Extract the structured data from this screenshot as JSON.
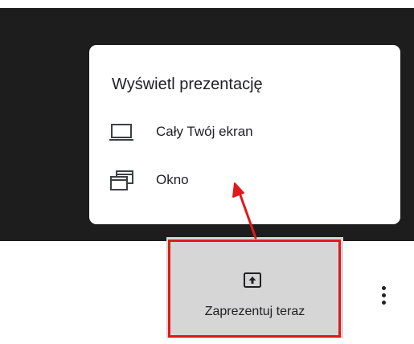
{
  "popup": {
    "title": "Wyświetl prezentację",
    "items": [
      {
        "label": "Cały Twój ekran",
        "icon": "laptop-icon"
      },
      {
        "label": "Okno",
        "icon": "window-icon"
      }
    ]
  },
  "toolbar": {
    "present_label": "Zaprezentuj teraz",
    "present_icon": "present-to-all-icon",
    "more_icon": "more-vert-icon"
  },
  "annotation": {
    "highlight_color": "#e0191b",
    "arrow_color": "#e0191b"
  },
  "colors": {
    "dark_background": "#1d1d1d",
    "button_background": "#d6d6d6"
  }
}
